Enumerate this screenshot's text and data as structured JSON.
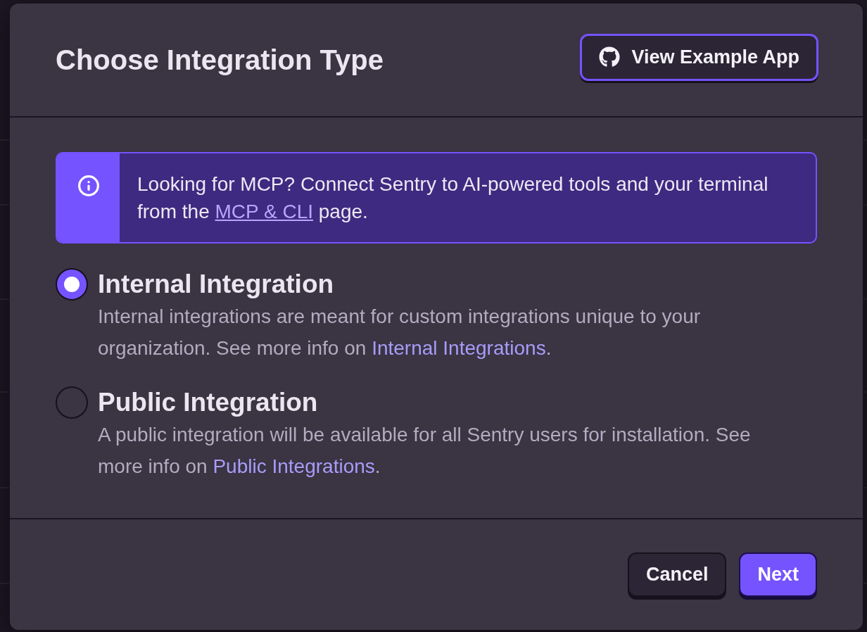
{
  "modal": {
    "title": "Choose Integration Type",
    "header_button": {
      "label": "View Example App"
    },
    "alert": {
      "kind": "info",
      "text_before": "Looking for MCP? Connect Sentry to AI-powered tools and your terminal from the ",
      "link": "MCP & CLI",
      "text_after": " page."
    },
    "options": [
      {
        "title": "Internal Integration",
        "selected": true,
        "description": "Internal integrations are meant for custom integrations unique to your organization. See more info on ",
        "link": "Internal Integrations",
        "description_end": "."
      },
      {
        "title": "Public Integration",
        "selected": false,
        "description": "A public integration will be available for all Sentry users for installation. See more info on ",
        "link": "Public Integrations",
        "description_end": "."
      }
    ],
    "buttons": [
      {
        "label": "Cancel",
        "kind": "secondary"
      },
      {
        "label": "Next",
        "kind": "primary"
      }
    ]
  }
}
